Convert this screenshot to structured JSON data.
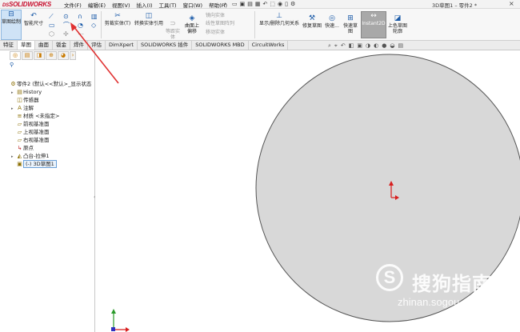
{
  "app": {
    "logo_brand": "DS",
    "logo_name": "SOLIDWORKS",
    "doc_title": "3D草图1 – 零件2 *",
    "menu": [
      "文件(F)",
      "编辑(E)",
      "视图(V)",
      "插入(I)",
      "工具(T)",
      "窗口(W)",
      "帮助(H)"
    ],
    "close_glyph": "×",
    "pin_glyph": "→"
  },
  "command_manager": {
    "sketch_label": "草图绘制",
    "smart_dim_label": "智能尺寸",
    "trim_label": "剪裁实体(T)",
    "convert_label": "转换实体引用",
    "equidistant_label": "等距实体",
    "surface_offset_label": "曲面上偏移",
    "mirror_label": "镜向实体",
    "linear_pattern_label": "线性草图阵列",
    "move_label": "移动实体",
    "show_relations_label": "显示/删除几何关系",
    "repair_label": "修复草图",
    "quick_snap_label": "快速...",
    "quick_sketch_label": "快速草图",
    "instant2d_label": "Instant2D",
    "shaded_label": "上色草图轮廓"
  },
  "tabs": [
    "特征",
    "草图",
    "曲面",
    "钣金",
    "焊件",
    "评估",
    "DimXpert",
    "SOLIDWORKS 插件",
    "SOLIDWORKS MBD",
    "CircuitWorks"
  ],
  "active_tab_index": 1,
  "tree": {
    "root": "零件2 (默认<<默认>_显示状态",
    "items": [
      {
        "label": "History",
        "arrow": "▸"
      },
      {
        "label": "传感器",
        "arrow": ""
      },
      {
        "label": "注解",
        "arrow": "▸"
      },
      {
        "label": "材质 <未指定>",
        "arrow": ""
      },
      {
        "label": "前视基准面",
        "arrow": ""
      },
      {
        "label": "上视基准面",
        "arrow": ""
      },
      {
        "label": "右视基准面",
        "arrow": ""
      },
      {
        "label": "原点",
        "arrow": ""
      },
      {
        "label": "凸台-拉伸1",
        "arrow": "▸"
      },
      {
        "label": "3D草图1",
        "arrow": "",
        "prefix": "(-)"
      }
    ]
  },
  "watermark": {
    "logo": "S",
    "text": "搜狗指南",
    "url": "zhinan.sogou.com"
  },
  "colors": {
    "accent": "#1a5aa8",
    "circle_fill": "#d8d8d8",
    "arrow_red": "#e03030",
    "origin_red": "#d81e1e"
  }
}
